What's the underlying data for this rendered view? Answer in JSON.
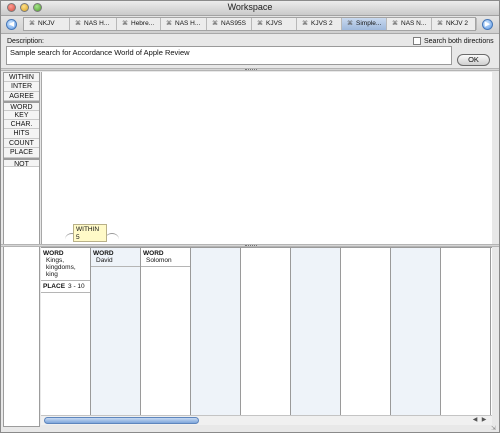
{
  "window": {
    "title": "Workspace"
  },
  "tabs": [
    {
      "label": "NKJV",
      "active": false
    },
    {
      "label": "NAS H...",
      "active": false
    },
    {
      "label": "Hebre...",
      "active": false
    },
    {
      "label": "NAS H...",
      "active": false
    },
    {
      "label": "NAS95S",
      "active": false
    },
    {
      "label": "KJVS",
      "active": false
    },
    {
      "label": "KJVS 2",
      "active": false
    },
    {
      "label": "Simple...",
      "active": true
    },
    {
      "label": "NAS N...",
      "active": false
    },
    {
      "label": "NKJV 2",
      "active": false
    }
  ],
  "description": {
    "label": "Description:",
    "value": "Sample search for Accordance World of Apple Review",
    "search_both_label": "Search both directions",
    "search_both_checked": false,
    "ok_label": "OK"
  },
  "commands": [
    "WITHIN",
    "INTER",
    "AGREE",
    "WORD",
    "KEY",
    "CHAR.",
    "HITS",
    "COUNT",
    "PLACE",
    "NOT"
  ],
  "within_box": {
    "label": "WITHIN",
    "value": "5"
  },
  "columns": [
    {
      "items": [
        {
          "type": "WORD",
          "value": "Kings, kingdoms, king"
        },
        {
          "type": "PLACE",
          "value": "3 - 10"
        }
      ]
    },
    {
      "items": [
        {
          "type": "WORD",
          "value": "David"
        }
      ]
    },
    {
      "items": [
        {
          "type": "WORD",
          "value": "Solomon"
        }
      ]
    }
  ],
  "colors": {
    "accent": "#7ea6db",
    "shade": "#eef3f9",
    "note": "#fffac8"
  }
}
